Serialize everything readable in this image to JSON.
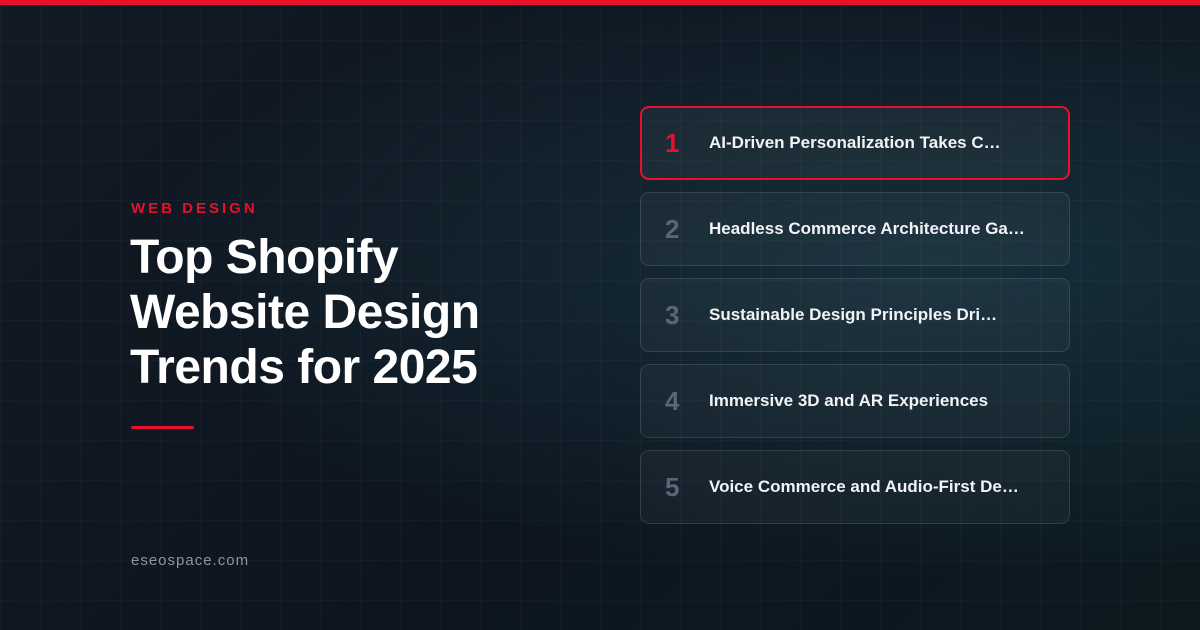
{
  "colors": {
    "accent": "#e8102b",
    "muted_number": "#5a6678",
    "domain_text": "#8a95a5"
  },
  "hero": {
    "eyebrow": "WEB DESIGN",
    "title": "Top Shopify Website Design Trends for 2025",
    "domain": "eseospace.com"
  },
  "trends": [
    {
      "number": "1",
      "label": "AI-Driven Personalization Takes C…",
      "active": true
    },
    {
      "number": "2",
      "label": "Headless Commerce Architecture Ga…",
      "active": false
    },
    {
      "number": "3",
      "label": "Sustainable Design Principles Dri…",
      "active": false
    },
    {
      "number": "4",
      "label": "Immersive 3D and AR Experiences",
      "active": false
    },
    {
      "number": "5",
      "label": "Voice Commerce and Audio-First De…",
      "active": false
    }
  ]
}
